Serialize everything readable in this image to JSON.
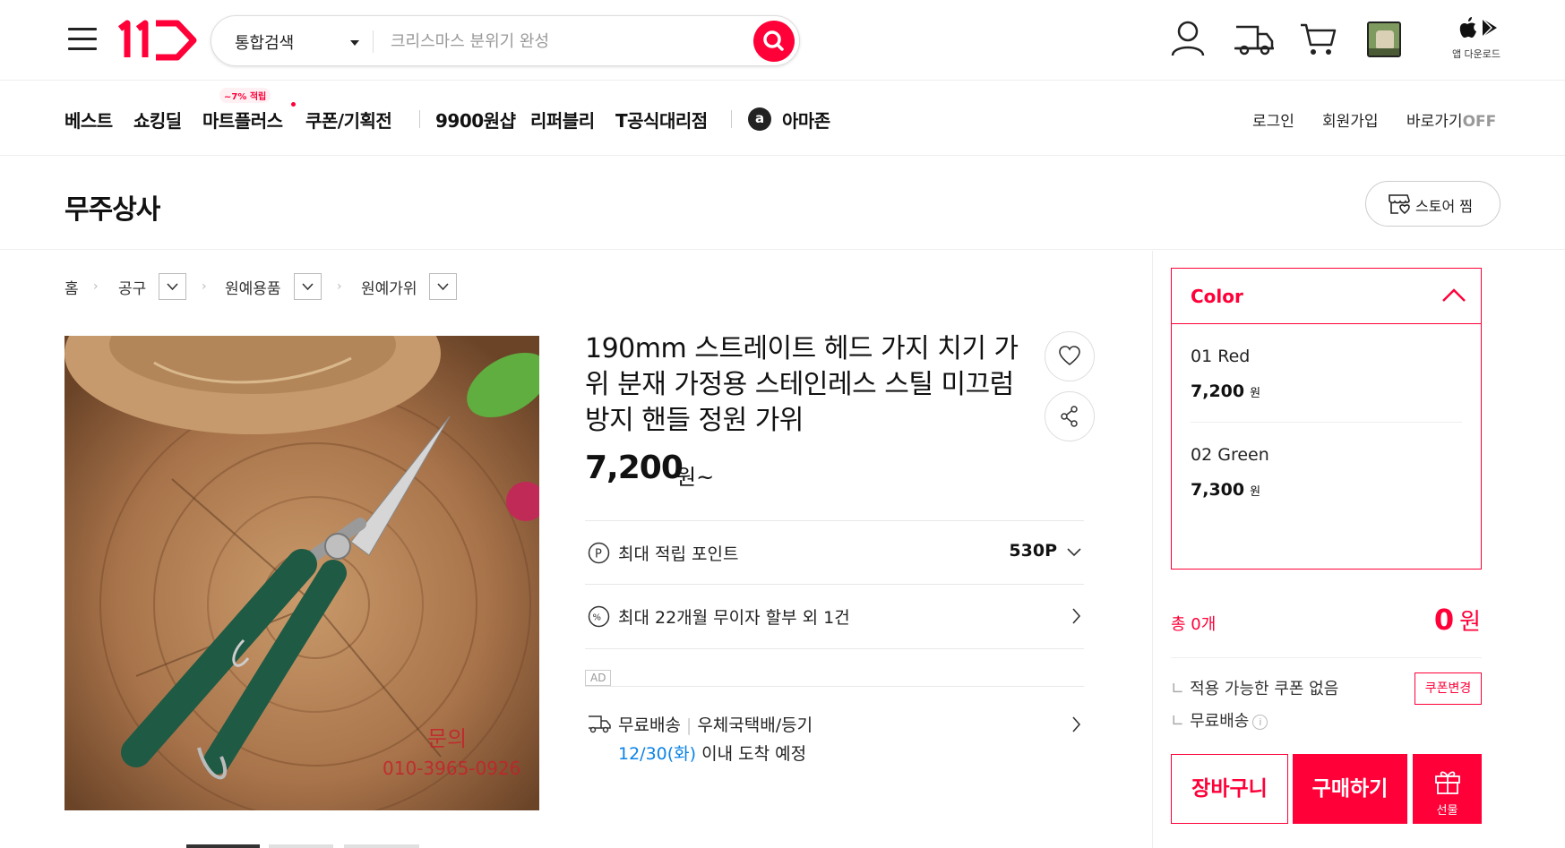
{
  "header": {
    "logo": "11번가",
    "search_scope": "통합검색",
    "search_placeholder": "크리스마스 분위기 완성",
    "app_download": "앱 다운로드"
  },
  "nav": {
    "items": [
      "베스트",
      "쇼킹딜",
      "마트플러스",
      "쿠폰/기획전",
      "9900원샵",
      "리퍼블리",
      "T공식대리점",
      "아마존"
    ],
    "badge": "~7% 적립",
    "amazon_mark": "a",
    "login": "로그인",
    "signup": "회원가입",
    "shortcut": "바로가기",
    "shortcut_state": "OFF"
  },
  "store": {
    "name": "무주상사",
    "favorite_label": "스토어 찜"
  },
  "breadcrumb": [
    "홈",
    "공구",
    "원예용품",
    "원예가위"
  ],
  "product": {
    "title": "190mm 스트레이트 헤드 가지 치기 가위 분재 가정용 스테인레스 스틸 미끄럼 방지 핸들 정원 가위",
    "price": "7,200",
    "price_unit": "원~",
    "image_overlay_text": "문의",
    "image_overlay_phone": "010-3965-0926",
    "points_label": "최대 적립 포인트",
    "points_value": "530P",
    "installment": "최대 22개월 무이자 할부 외 1건",
    "ad_tag": "AD",
    "shipping_free": "무료배송",
    "shipping_carrier": "우체국택배/등기",
    "arrival_date": "12/30(화)",
    "arrival_suffix": " 이내 도착 예정"
  },
  "options": {
    "header": "Color",
    "items": [
      {
        "name": "01 Red",
        "price": "7,200",
        "unit": "원"
      },
      {
        "name": "02 Green",
        "price": "7,300",
        "unit": "원"
      }
    ]
  },
  "order": {
    "total_label": "총 0개",
    "total_value": "0",
    "total_unit": "원",
    "coupon_status": "적용 가능한 쿠폰 없음",
    "coupon_button": "쿠폰변경",
    "shipping": "무료배송",
    "cart_button": "장바구니",
    "buy_button": "구매하기",
    "gift_button": "선물"
  },
  "colors": {
    "brand": "#ff0038",
    "link_blue": "#0b83e6"
  }
}
